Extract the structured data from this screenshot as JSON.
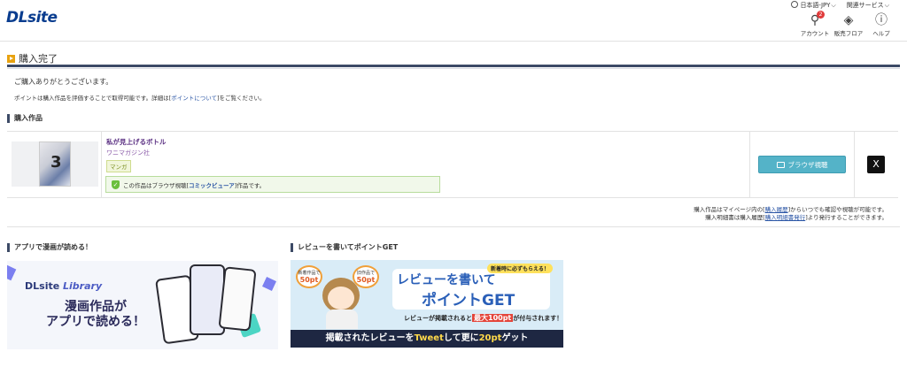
{
  "header": {
    "logo": "DLsite",
    "language": "日本語-JPY",
    "related_services": "関連サービス",
    "account_label": "アカウント",
    "account_badge": "2",
    "floor_label": "販売フロア",
    "help_label": "ヘルプ"
  },
  "page": {
    "title": "購入完了",
    "thanks": "ご購入ありがとうございます。",
    "points_note_prefix": "ポイントは購入作品を評価することで取得可能です。詳細は[",
    "points_link": "ポイントについて",
    "points_note_suffix": "]をご覧ください。"
  },
  "purchased": {
    "section_title": "購入作品",
    "item": {
      "title": "私が見上げるボトル",
      "circle": "ワニマガジン社",
      "tag": "マンガ",
      "notice_prefix": "この作品はブラウザ視聴[",
      "notice_link": "コミックビューア",
      "notice_suffix": "]作品です。",
      "viewer_button": "ブラウザ視聴",
      "share_icon": "X"
    },
    "history_note_1_prefix": "購入作品はマイページ内の[",
    "history_note_1_link": "購入履歴",
    "history_note_1_suffix": "]からいつでも確認や視聴が可能です。",
    "history_note_2_prefix": "購入明細書は購入履歴[",
    "history_note_2_link": "購入明細書発行",
    "history_note_2_suffix": "]より発行することができます。"
  },
  "banners": {
    "app": {
      "section_title": "アプリで漫画が読める！",
      "logo_main": "DLsite",
      "logo_sub": "Library",
      "text_line1": "漫画作品が",
      "text_line2": "アプリで読める！"
    },
    "review": {
      "section_title": "レビューを書いてポイントGET",
      "bubble1_small": "新着作品で",
      "bubble1_pt": "50pt",
      "bubble2_small": "旧作品で",
      "bubble2_pt": "50pt",
      "tag": "新着時に必ずもらえる！",
      "headline1": "レビューを書いて",
      "headline2": "ポイントGET",
      "sub_prefix": "レビューが掲載されると",
      "sub_highlight": "最大100pt",
      "sub_suffix": "が付与されます！",
      "bottom_prefix": "掲載されたレビューを",
      "bottom_hl1": "Tweet",
      "bottom_mid": "して更に",
      "bottom_hl2": "20pt",
      "bottom_suffix": "ゲット"
    }
  }
}
